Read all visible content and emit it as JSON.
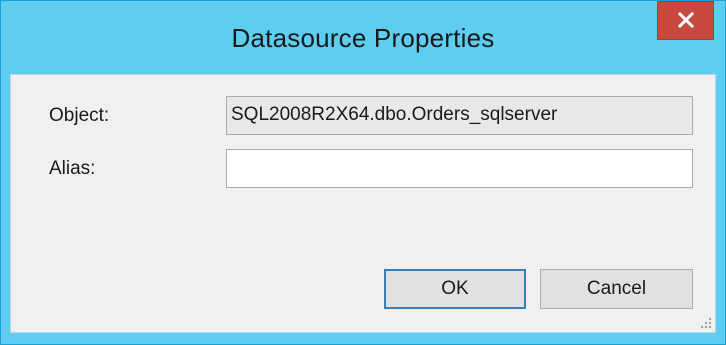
{
  "window": {
    "title": "Datasource Properties"
  },
  "form": {
    "object_label": "Object:",
    "object_value": "SQL2008R2X64.dbo.Orders_sqlserver",
    "alias_label": "Alias:",
    "alias_value": ""
  },
  "buttons": {
    "ok_label": "OK",
    "cancel_label": "Cancel"
  },
  "colors": {
    "titlebar": "#5fcdf0",
    "close_button": "#c7483e",
    "client_background": "#f0f0f0"
  }
}
